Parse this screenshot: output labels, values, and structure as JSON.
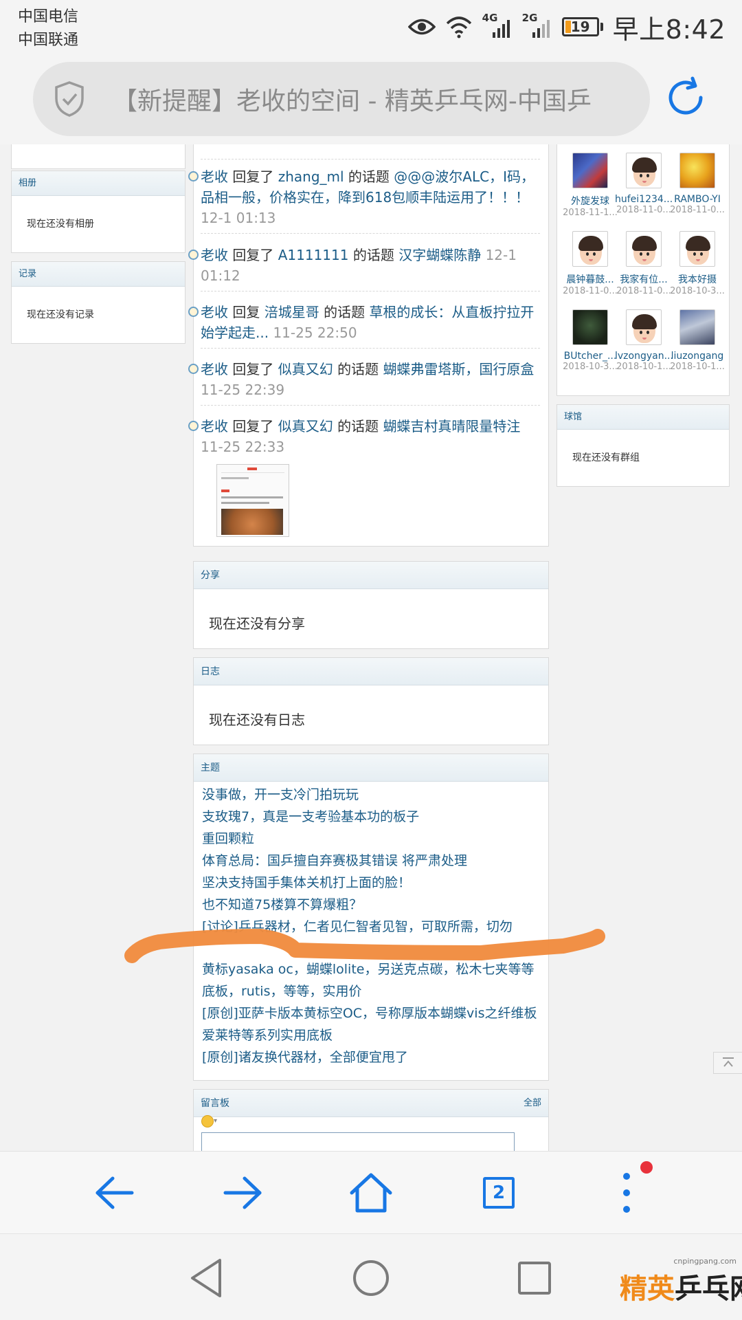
{
  "status_bar": {
    "carrier_1": "中国电信",
    "carrier_2": "中国联通",
    "signal_1_label": "4G",
    "signal_2_label": "2G",
    "battery": "19",
    "time": "早上8:42"
  },
  "url_bar": {
    "title": "【新提醒】老收的空间 - 精英乒乓网-中国乒"
  },
  "left_sidebar": {
    "album": {
      "title": "相册",
      "empty": "现在还没有相册"
    },
    "record": {
      "title": "记录",
      "empty": "现在还没有记录"
    }
  },
  "feed": [
    {
      "user": "老收",
      "action": "回复了",
      "target": "zhang_ml",
      "suffix": "的话题",
      "topic": "@@@波尔ALC，I码，品相一般，价格实在，降到618包顺丰陆运用了！！！",
      "time": "12-1 01:13"
    },
    {
      "user": "老收",
      "action": "回复了",
      "target": "A1111111",
      "suffix": "的话题",
      "topic": "汉字蝴蝶陈静",
      "time": "12-1 01:12"
    },
    {
      "user": "老收",
      "action": "回复",
      "target": "涪城星哥",
      "suffix": "的话题",
      "topic": "草根的成长：从直板拧拉开始学起走...",
      "time": "11-25 22:50"
    },
    {
      "user": "老收",
      "action": "回复了",
      "target": "似真又幻",
      "suffix": "的话题",
      "topic": "蝴蝶弗雷塔斯，国行原盒",
      "time": "11-25 22:39"
    },
    {
      "user": "老收",
      "action": "回复了",
      "target": "似真又幻",
      "suffix": "的话题",
      "topic": "蝴蝶吉村真晴限量特注",
      "time": "11-25 22:33"
    }
  ],
  "share": {
    "title": "分享",
    "empty": "现在还没有分享"
  },
  "blog": {
    "title": "日志",
    "empty": "现在还没有日志"
  },
  "topics": {
    "title": "主题",
    "items": [
      "没事做，开一支冷门拍玩玩",
      "支玫瑰7，真是一支考验基本功的板子",
      "重回颗粒",
      "体育总局：国乒擅自弃赛极其错误 将严肃处理",
      "坚决支持国手集体关机打上面的脸！",
      "也不知道75楼算不算爆粗？",
      "[讨论]乒乓器材，仁者见仁智者见智，可取所需，切勿",
      "黄标yasaka oc，蝴蝶lolite，另送克点碳，松木七夹等等底板，rutis，等等，实用价",
      "[原创]亚萨卡版本黄标空OC，号称厚版本蝴蝶vis之纤维板爱莱特等系列实用底板",
      "[原创]诸友换代器材，全部便宜甩了"
    ]
  },
  "guestbook": {
    "title": "留言板",
    "all_link": "全部"
  },
  "friends": [
    {
      "name": "外旋发球",
      "date": "2018-11-1..."
    },
    {
      "name": "hufei1234...",
      "date": "2018-11-0..."
    },
    {
      "name": "RAMBO-YI",
      "date": "2018-11-0..."
    },
    {
      "name": "晨钟暮鼓...",
      "date": "2018-11-0..."
    },
    {
      "name": "我家有位...",
      "date": "2018-11-0..."
    },
    {
      "name": "我本好摄",
      "date": "2018-10-3..."
    },
    {
      "name": "BUtcher_...",
      "date": "2018-10-3..."
    },
    {
      "name": "lvzongyan...",
      "date": "2018-10-1..."
    },
    {
      "name": "liuzongang",
      "date": "2018-10-1..."
    }
  ],
  "club": {
    "title": "球馆",
    "empty": "现在还没有群组"
  },
  "toolbar": {
    "tab_count": "2"
  },
  "watermark": {
    "url": "cnpingpang.com",
    "logo_1": "精英",
    "logo_2": "乒乓网"
  },
  "colors": {
    "link": "#1b5c87",
    "accent": "#1877e4",
    "annotation_stroke": "#f08a3c"
  }
}
